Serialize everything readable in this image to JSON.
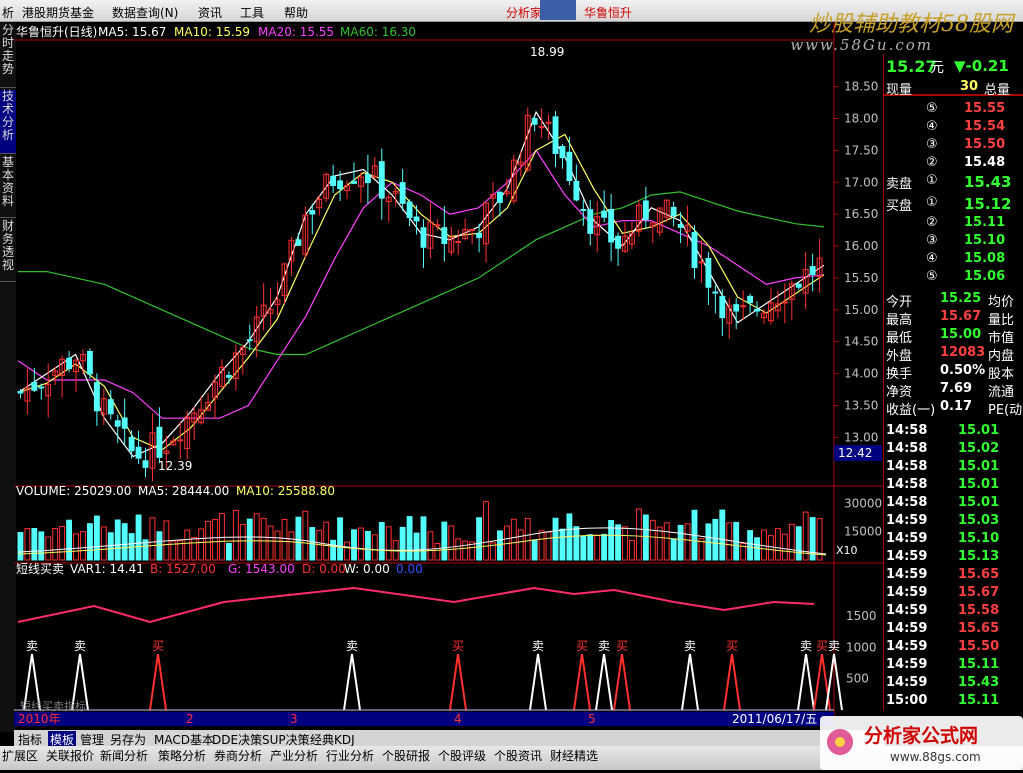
{
  "menu": {
    "items": [
      "析",
      "港股期货基金",
      "数据查询(N)",
      "资讯",
      "工具",
      "帮助"
    ],
    "analyst": "分析家",
    "stock": "华鲁恒升",
    "brand": "炒股辅助教材58股网",
    "url": "www.58Gu.com"
  },
  "left_tabs": [
    "分时走势",
    "技术分析",
    "基本资料",
    "财务透视"
  ],
  "indicators": {
    "price_title": "华鲁恒升(日线)",
    "ma5": "MA5: 15.67",
    "ma10": "MA10: 15.59",
    "ma20": "MA20: 15.55",
    "ma60": "MA60: 16.30",
    "vol_title": "VOLUME: 25029.00",
    "vol_ma5": "MA5: 28444.00",
    "vol_ma10": "MA10: 25588.80",
    "var_title": "短线买卖",
    "var1": "VAR1: 14.41",
    "b": "B: 1527.00",
    "g": "G: 1543.00",
    "d": "D: 0.00",
    "w": "W: 0.00",
    "extra": "0.00"
  },
  "labels": {
    "high": "18.99",
    "low": "12.39",
    "cursor_price": "12.42",
    "vol_scale": "X10",
    "signal_buy": "买",
    "signal_sell": "卖",
    "bottom_text": "短线买卖指标",
    "year": "2010年",
    "months": [
      "2",
      "3",
      "4",
      "5"
    ],
    "date": "2011/06/17/五"
  },
  "colors": {
    "up": "#ff3030",
    "down": "#54ffff",
    "ma5": "#ffffff",
    "ma10": "#ffff60",
    "ma20": "#ff40ff",
    "ma60": "#30c030",
    "axis": "#b00000",
    "var1": "#ff2a6a"
  },
  "chart_data": {
    "type": "candlestick",
    "title": "华鲁恒升(日线)",
    "y_ticks": [
      13.0,
      13.5,
      14.0,
      14.5,
      15.0,
      15.5,
      16.0,
      16.5,
      17.0,
      17.5,
      18.0,
      18.5
    ],
    "ylim": [
      12.3,
      19.2
    ],
    "vol_ticks": [
      15000,
      30000
    ],
    "var_ticks": [
      500,
      1000,
      1500
    ],
    "ohlc": [],
    "ma60": [
      15.6,
      15.6,
      15.5,
      15.4,
      15.2,
      15.0,
      14.8,
      14.6,
      14.4,
      14.3,
      14.3,
      14.5,
      14.7,
      14.9,
      15.1,
      15.3,
      15.5,
      15.8,
      16.1,
      16.3,
      16.5,
      16.6,
      16.8,
      16.85,
      16.7,
      16.55,
      16.45,
      16.35,
      16.3
    ],
    "ma20": [
      14.2,
      13.9,
      13.9,
      13.9,
      13.7,
      13.3,
      13.3,
      13.3,
      13.5,
      14.2,
      14.9,
      15.8,
      16.6,
      17.0,
      16.8,
      16.5,
      16.6,
      17.0,
      17.5,
      16.8,
      16.3,
      16.4,
      16.4,
      16.2,
      16.0,
      15.7,
      15.4,
      15.5,
      15.55
    ],
    "ma5": [
      13.7,
      14.0,
      14.3,
      13.3,
      12.7,
      12.9,
      13.4,
      14.0,
      14.5,
      15.2,
      16.5,
      17.1,
      17.2,
      16.8,
      16.2,
      16.1,
      16.3,
      16.9,
      18.1,
      17.4,
      16.4,
      16.0,
      16.6,
      16.4,
      15.6,
      14.8,
      15.1,
      15.4,
      15.7
    ],
    "signals": [
      "sell",
      "sell",
      "buy",
      "sell",
      "buy",
      "sell",
      "buy",
      "sell",
      "buy",
      "sell",
      "buy",
      "sell",
      "buy",
      "sell"
    ],
    "volume_note": "volume bars colored up/down"
  },
  "quote": {
    "price": "15.27",
    "unit": "元",
    "change": "▼-0.21",
    "cur_vol_label": "现量",
    "cur_vol": "30",
    "total_label": "总量",
    "sell": [
      {
        "n": "⑤",
        "p": "15.55"
      },
      {
        "n": "④",
        "p": "15.54"
      },
      {
        "n": "③",
        "p": "15.50"
      },
      {
        "n": "②",
        "p": "15.48"
      },
      {
        "n": "①",
        "p": "15.43",
        "label": "卖盘"
      }
    ],
    "buy": [
      {
        "n": "①",
        "p": "15.12",
        "label": "买盘"
      },
      {
        "n": "②",
        "p": "15.11"
      },
      {
        "n": "③",
        "p": "15.10"
      },
      {
        "n": "④",
        "p": "15.08"
      },
      {
        "n": "⑤",
        "p": "15.06"
      }
    ],
    "stats": [
      {
        "l": "今开",
        "v": "15.25",
        "r": "均价"
      },
      {
        "l": "最高",
        "v": "15.67",
        "r": "量比"
      },
      {
        "l": "最低",
        "v": "15.00",
        "r": "市值"
      },
      {
        "l": "外盘",
        "v": "12083",
        "r": "内盘"
      },
      {
        "l": "换手",
        "v": "0.50%",
        "r": "股本"
      },
      {
        "l": "净资",
        "v": "7.69",
        "r": "流通"
      },
      {
        "l": "收益(一)",
        "v": "0.17",
        "r": "PE(动)"
      }
    ],
    "ticks": [
      {
        "t": "14:58",
        "p": "15.01"
      },
      {
        "t": "14:58",
        "p": "15.02"
      },
      {
        "t": "14:58",
        "p": "15.01"
      },
      {
        "t": "14:58",
        "p": "15.01"
      },
      {
        "t": "14:58",
        "p": "15.01"
      },
      {
        "t": "14:59",
        "p": "15.03"
      },
      {
        "t": "14:59",
        "p": "15.10"
      },
      {
        "t": "14:59",
        "p": "15.13"
      },
      {
        "t": "14:59",
        "p": "15.65"
      },
      {
        "t": "14:59",
        "p": "15.67"
      },
      {
        "t": "14:59",
        "p": "15.58"
      },
      {
        "t": "14:59",
        "p": "15.65"
      },
      {
        "t": "14:59",
        "p": "15.50"
      },
      {
        "t": "14:59",
        "p": "15.11"
      },
      {
        "t": "14:59",
        "p": "15.43"
      },
      {
        "t": "15:00",
        "p": "15.11"
      }
    ]
  },
  "bottom_tabs": [
    "指标",
    "模板",
    "管理",
    "另存为",
    "MACD基本",
    "DDE决策",
    "SUP决策",
    "经典KDJ"
  ],
  "status_tabs": [
    "扩展区",
    "关联报价",
    "新闻分析",
    "策略分析",
    "券商分析",
    "产业分析",
    "行业分析",
    "个股研报",
    "个股评级",
    "个股资讯",
    "财经精选"
  ],
  "logo": {
    "text": "分析家公式网",
    "url": "www.88gs.com"
  }
}
